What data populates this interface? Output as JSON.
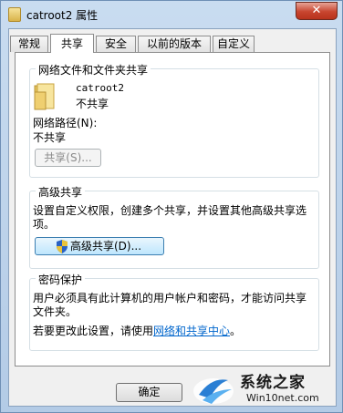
{
  "window": {
    "title": "catroot2 属性",
    "close_label": "✕"
  },
  "tabs": [
    {
      "label": "常规"
    },
    {
      "label": "共享",
      "active": true
    },
    {
      "label": "安全"
    },
    {
      "label": "以前的版本"
    },
    {
      "label": "自定义"
    }
  ],
  "network_sharing": {
    "group_title": "网络文件和文件夹共享",
    "folder_name": "catroot2",
    "folder_status": "不共享",
    "path_label": "网络路径(N):",
    "path_value": "不共享",
    "share_button": "共享(S)..."
  },
  "advanced_sharing": {
    "group_title": "高级共享",
    "description_line1": "设置自定义权限，创建多个共享，并设置其他高级共享选",
    "description_line2": "项。",
    "button": "高级共享(D)..."
  },
  "password_protection": {
    "group_title": "密码保护",
    "line1": "用户必须具有此计算机的用户帐户和密码，才能访问共享",
    "line2": "文件夹。",
    "line3_prefix": "若要更改此设置，请使用",
    "link": "网络和共享中心",
    "line3_suffix": "。"
  },
  "footer": {
    "ok_button": "确定"
  },
  "watermark": {
    "brand": "系统之家",
    "url": "Win10net.com"
  }
}
